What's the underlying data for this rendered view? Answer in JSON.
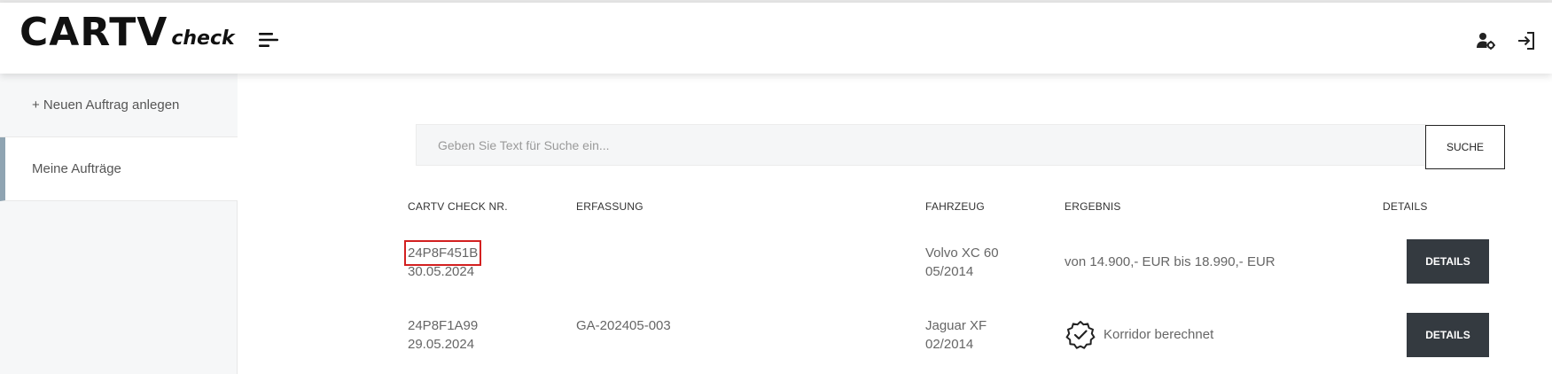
{
  "header": {
    "logo_main": "CARTV",
    "logo_sub": "check"
  },
  "sidebar": {
    "items": [
      {
        "label": "+ Neuen Auftrag anlegen"
      },
      {
        "label": "Meine Aufträge"
      }
    ]
  },
  "search": {
    "placeholder": "Geben Sie Text für Suche ein...",
    "value": "",
    "button_label": "SUCHE"
  },
  "table": {
    "columns": [
      "CARTV CHECK NR.",
      "ERFASSUNG",
      "FAHRZEUG",
      "ERGEBNIS",
      "DETAILS"
    ],
    "rows": [
      {
        "check_nr": "24P8F451B",
        "date": "30.05.2024",
        "erfassung": "",
        "vehicle": "Volvo XC 60",
        "vehicle_date": "05/2014",
        "result": "von 14.900,- EUR bis 18.990,- EUR",
        "details_label": "DETAILS"
      },
      {
        "check_nr": "24P8F1A99",
        "date": "29.05.2024",
        "erfassung": "GA-202405-003",
        "vehicle": "Jaguar XF",
        "vehicle_date": "02/2014",
        "result": "Korridor berechnet",
        "details_label": "DETAILS"
      }
    ]
  },
  "icons": {
    "menu": "hamburger-menu-icon",
    "user_settings": "user-settings-icon",
    "logout": "logout-icon",
    "result_badge": "verified-badge-icon"
  },
  "colors": {
    "accent_bar": "#8fa4b2",
    "button_dark": "#343a40",
    "highlight": "#d32020"
  }
}
